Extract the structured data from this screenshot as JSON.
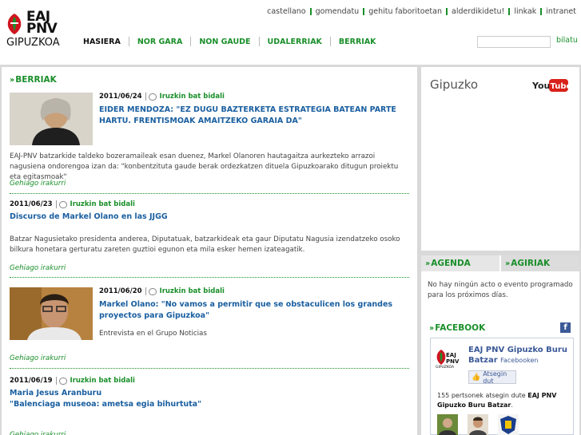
{
  "brand": {
    "logo_line1": "EAJ",
    "logo_line2": "PNV",
    "logo_line3": "GIPUZKOA"
  },
  "top_links": [
    "castellano",
    "gomendatu",
    "gehitu faboritoetan",
    "alderdikidetu!",
    "linkak",
    "intranet"
  ],
  "nav": [
    "HASIERA",
    "NOR GARA",
    "NON GAUDE",
    "UDALERRIAK",
    "BERRIAK"
  ],
  "search": {
    "button_label": "bilatu",
    "placeholder": ""
  },
  "news": {
    "section_title": "BERRIAK",
    "comment_label": "Iruzkin bat bidali",
    "more_label": "Gehiago irakurri",
    "posts": [
      {
        "date": "2011/06/24",
        "title": "EIDER MENDOZA: \"EZ DUGU BAZTERKETA ESTRATEGIA BATEAN PARTE HARTU. FRENTISMOAK AMAITZEKO GARAIA DA\"",
        "excerpt": "EAJ-PNV batzarkide taldeko bozeramaileak esan duenez, Markel Olanoren hautagaitza aurkezteko arrazoi nagusiena ondorengoa izan da: \"konbentzituta gaude berak ordezkatzen dituela Gipuzkoarako ditugun proiektu eta egitasmoak\""
      },
      {
        "date": "2011/06/23",
        "title": "Discurso de Markel Olano en las JJGG",
        "excerpt": "Batzar Nagusietako presidenta anderea, Diputatuak, batzarkideak eta gaur Diputatu Nagusia izendatzeko osoko bilkura honetara gerturatu zareten guztioi egunon eta mila esker hemen izateagatik."
      },
      {
        "date": "2011/06/20",
        "title": "Markel Olano: \"No vamos a permitir que se obstaculicen los grandes proyectos para Gipuzkoa\"",
        "excerpt": "Entrevista en el Grupo Noticias"
      },
      {
        "date": "2011/06/19",
        "title_line1": "Maria Jesus Aranburu",
        "title_line2": "\"Balenciaga museoa: ametsa egia bihurtuta\""
      }
    ]
  },
  "sidebar": {
    "youtube_title": "Gipuzko",
    "youtube_logo_text": "YouTube",
    "agenda_tab": "AGENDA",
    "agiriak_tab": "AGIRIAK",
    "agenda_text": "No hay ningún acto o evento programado para los próximos días.",
    "facebook_title": "FACEBOOK",
    "fb_page_name": "EAJ PNV Gipuzko Buru Batzar",
    "fb_page_sub": "Facebooken",
    "fb_like": "Atsegin dut",
    "fb_fans_prefix": "155 pertsonek atsegin dute ",
    "fb_fans_page": "EAJ PNV Gipuzko Buru Batzar",
    "fb_fans_suffix": "."
  },
  "colors": {
    "accent_green": "#1a8f2a",
    "link_blue": "#1a5fa0",
    "logo_red": "#d0141e",
    "facebook_blue": "#3b5998"
  }
}
